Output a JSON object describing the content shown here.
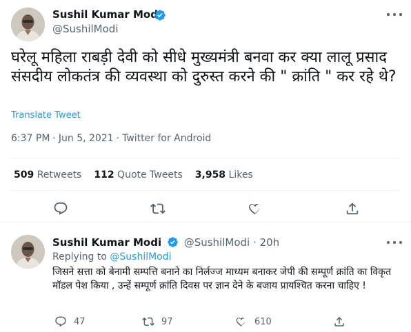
{
  "main_tweet": {
    "author_name": "Sushil Kumar Modi",
    "handle": "@SushilModi",
    "text": "घरेलू महिला राबड़ी देवी को सीधे मुख्यमंत्री बनवा कर क्या लालू प्रसाद संसदीय लोकतंत्र की व्यवस्था को दुरुस्त करने की \" क्रांति \" कर रहे थे?",
    "translate_label": "Translate Tweet",
    "time": "6:37 PM",
    "date": "Jun 5, 2021",
    "source": "Twitter for Android",
    "stats": {
      "retweets_count": "509",
      "retweets_label": "Retweets",
      "quotes_count": "112",
      "quotes_label": "Quote Tweets",
      "likes_count": "3,958",
      "likes_label": "Likes"
    }
  },
  "reply_tweet": {
    "author_name": "Sushil Kumar Modi",
    "handle": "@SushilModi",
    "age": "20h",
    "replying_prefix": "Replying to",
    "replying_to": "@SushilModi",
    "text": "जिसने सत्ता को बेनामी सम्पत्ति बनाने का निर्लज्ज माध्यम बनाकर  जेपी की सम्पूर्ण क्रांति का विकृत मॉडल पेश किया , उन्हें सम्पूर्ण क्रांति दिवस पर ज्ञान देने के बजाय प्रायश्चित करना चाहिए !",
    "replies": "47",
    "retweets": "97",
    "likes": "610"
  },
  "colors": {
    "accent": "#1d9bf0",
    "secondary_text": "#536471",
    "divider": "#eff3f4"
  },
  "icons": [
    "verified-icon",
    "more-icon",
    "reply-icon",
    "retweet-icon",
    "like-icon",
    "share-icon"
  ]
}
